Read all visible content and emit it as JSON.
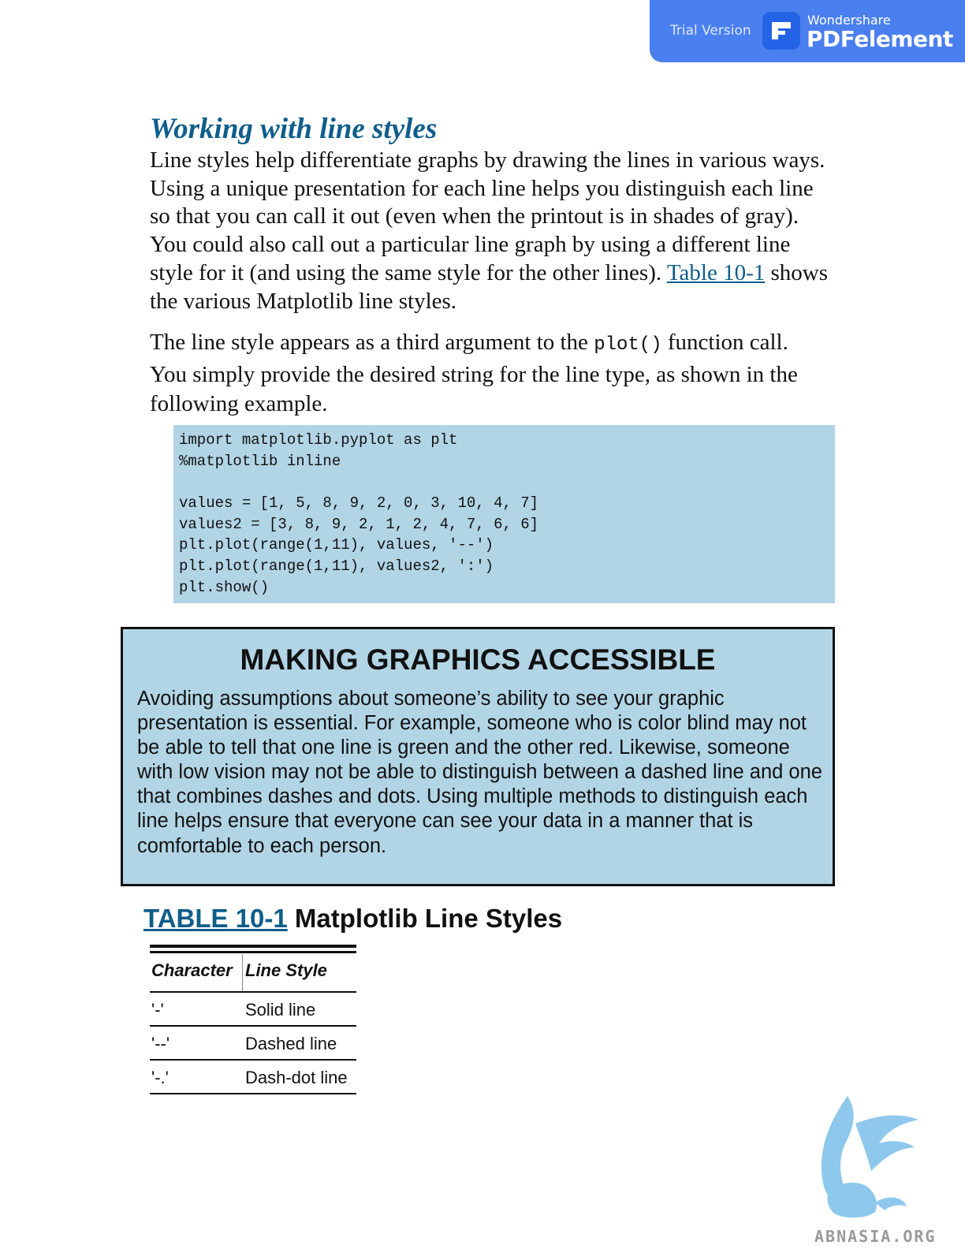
{
  "banner": {
    "trial_label": "Trial Version",
    "brand_small": "Wondershare",
    "brand_big": "PDFelement"
  },
  "section": {
    "heading": "Working with line styles",
    "p1_text": "Line styles help differentiate graphs by drawing the lines in various ways. Using a unique presentation for each line helps you distinguish each line so that you can call it out (even when the printout is in shades of gray). You could also call out a particular line graph by using a different line style for it (and using the same style for the other lines). ",
    "p1_link": "Table 10-1",
    "p1_tail": " shows the various Matplotlib line styles.",
    "p2_pre": "The line style appears as a third argument to the ",
    "p2_code": "plot()",
    "p2_post": " function call. You simply provide the desired string for the line type, as shown in the following example."
  },
  "code": {
    "lines": [
      "import matplotlib.pyplot as plt",
      "%matplotlib inline",
      "",
      "values = [1, 5, 8, 9, 2, 0, 3, 10, 4, 7]",
      "values2 = [3, 8, 9, 2, 1, 2, 4, 7, 6, 6]",
      "plt.plot(range(1,11), values, '--')",
      "plt.plot(range(1,11), values2, ':')",
      "plt.show()"
    ]
  },
  "sidebar": {
    "title": "MAKING GRAPHICS ACCESSIBLE",
    "body": "Avoiding assumptions about someone’s ability to see your graphic presentation is essential. For example, someone who is color blind may not be able to tell that one line is green and the other red. Likewise, someone with low vision may not be able to distinguish between a dashed line and one that combines dashes and dots. Using multiple methods to distinguish each line helps ensure that everyone can see your data in a manner that is comfortable to each person."
  },
  "table": {
    "title_link": "TABLE 10-1",
    "title_text": " Matplotlib Line Styles",
    "headers": [
      "Character",
      "Line Style"
    ],
    "rows": [
      [
        "'-'",
        "Solid line"
      ],
      [
        "'--'",
        "Dashed line"
      ],
      [
        "'-.'",
        "Dash-dot line"
      ]
    ]
  },
  "watermark": {
    "text": "ABNASIA.ORG",
    "color": "#8ec8ec"
  },
  "colors": {
    "banner": "#4a7ff0",
    "heading": "#0f5e8a",
    "box_fill": "#b2d5e6"
  }
}
